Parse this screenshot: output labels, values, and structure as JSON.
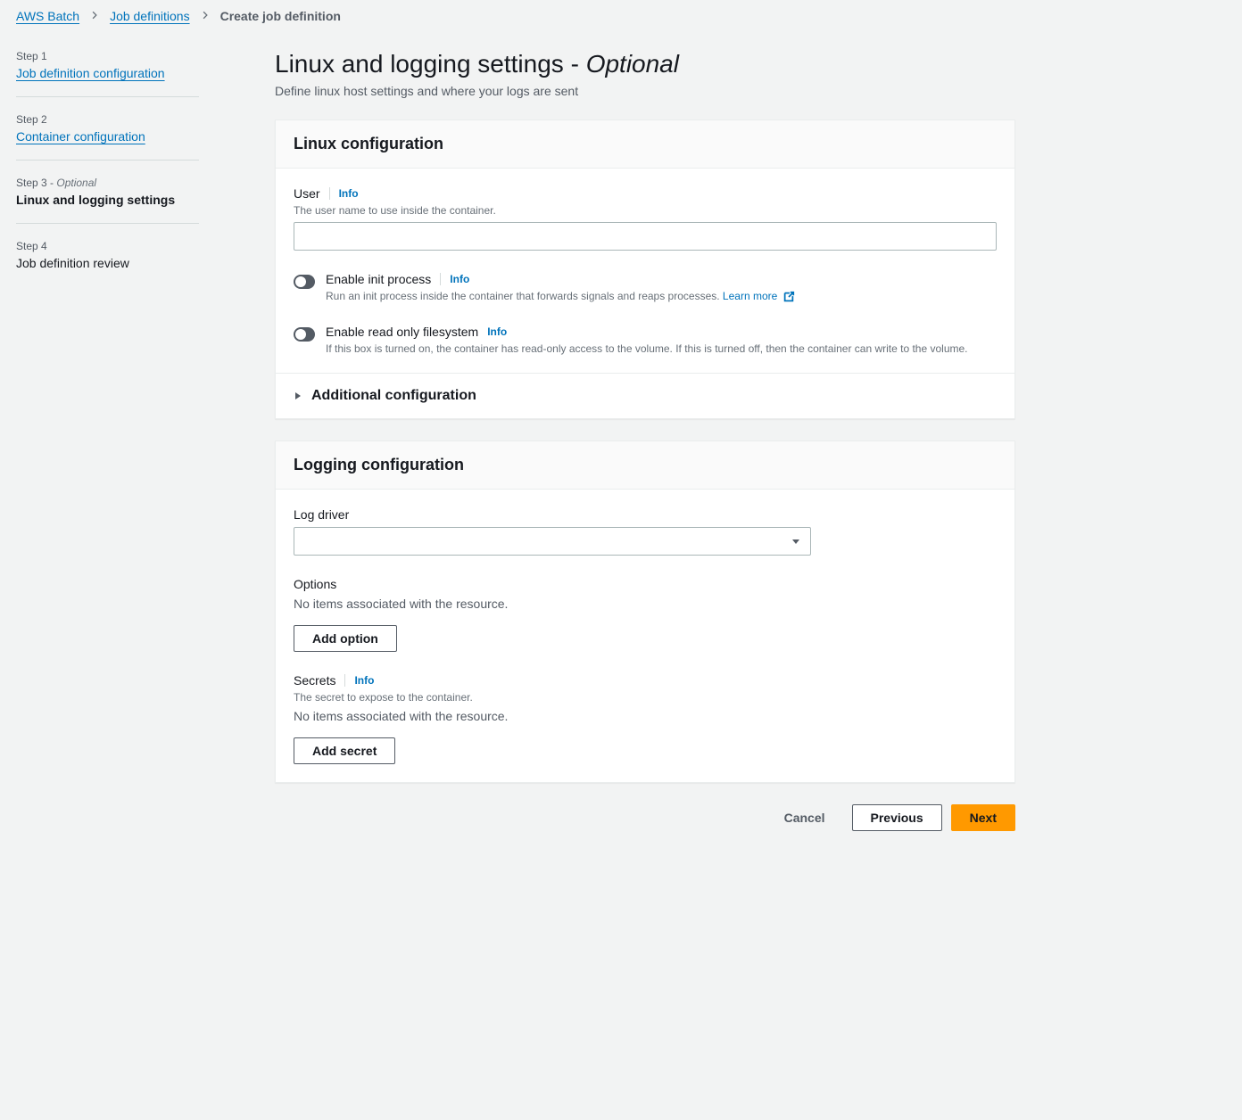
{
  "breadcrumb": {
    "items": [
      {
        "label": "AWS Batch"
      },
      {
        "label": "Job definitions"
      }
    ],
    "current": "Create job definition"
  },
  "sidebar": {
    "steps": [
      {
        "number": "Step 1",
        "title": "Job definition configuration",
        "link": true
      },
      {
        "number": "Step 2",
        "title": "Container configuration",
        "link": true
      },
      {
        "number": "Step 3",
        "optional": "Optional",
        "title": "Linux and logging settings",
        "current": true
      },
      {
        "number": "Step 4",
        "title": "Job definition review"
      }
    ]
  },
  "page": {
    "title_main": "Linux and logging settings",
    "title_separator": " - ",
    "title_optional": "Optional",
    "subtitle": "Define linux host settings and where your logs are sent"
  },
  "linux_panel": {
    "title": "Linux configuration",
    "user": {
      "label": "User",
      "info": "Info",
      "description": "The user name to use inside the container.",
      "value": ""
    },
    "init_process": {
      "label": "Enable init process",
      "info": "Info",
      "description": "Run an init process inside the container that forwards signals and reaps processes.",
      "learn_more": "Learn more"
    },
    "readonly_fs": {
      "label": "Enable read only filesystem",
      "info": "Info",
      "description": "If this box is turned on, the container has read-only access to the volume. If this is turned off, then the container can write to the volume."
    },
    "additional": "Additional configuration"
  },
  "logging_panel": {
    "title": "Logging configuration",
    "log_driver": {
      "label": "Log driver"
    },
    "options": {
      "label": "Options",
      "empty": "No items associated with the resource.",
      "add_button": "Add option"
    },
    "secrets": {
      "label": "Secrets",
      "info": "Info",
      "description": "The secret to expose to the container.",
      "empty": "No items associated with the resource.",
      "add_button": "Add secret"
    }
  },
  "footer": {
    "cancel": "Cancel",
    "previous": "Previous",
    "next": "Next"
  }
}
